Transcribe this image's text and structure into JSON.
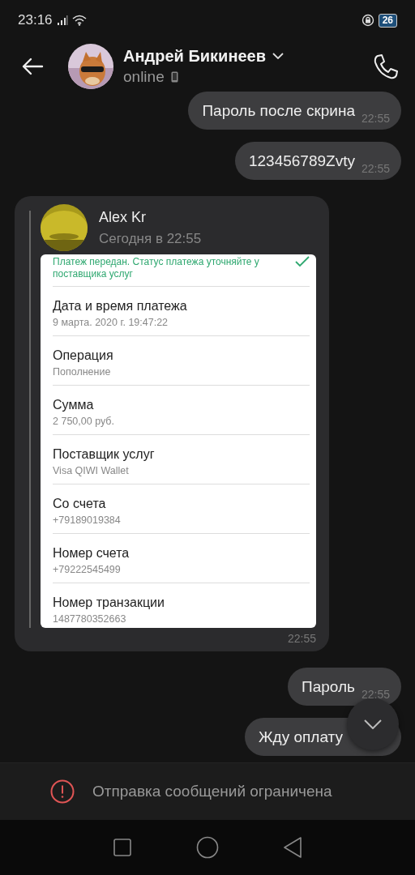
{
  "status_bar": {
    "time": "23:16",
    "battery": "26"
  },
  "header": {
    "name": "Андрей Бикинеев",
    "presence": "online"
  },
  "messages": [
    {
      "kind": "text",
      "text": "Пароль после скрина",
      "time": "22:55"
    },
    {
      "kind": "text",
      "text": "123456789Zvty",
      "time": "22:55"
    },
    {
      "kind": "forward",
      "author": "Alex Kr",
      "date": "Сегодня в 22:55",
      "time": "22:55",
      "screenshot": {
        "status": "Платеж передан. Статус платежа уточняйте у поставщика услуг",
        "rows": [
          {
            "label": "Дата и время платежа",
            "value": "9 марта. 2020 г. 19:47:22"
          },
          {
            "label": "Операция",
            "value": "Пополнение"
          },
          {
            "label": "Сумма",
            "value": "2 750,00 руб."
          },
          {
            "label": "Поставщик услуг",
            "value": "Visa QIWI Wallet"
          },
          {
            "label": "Со счета",
            "value": "+79189019384"
          },
          {
            "label": "Номер счета",
            "value": "+79222545499"
          },
          {
            "label": "Номер транзакции",
            "value": "1487780352663"
          }
        ]
      }
    },
    {
      "kind": "text",
      "text": "Пароль",
      "time": "22:55"
    },
    {
      "kind": "text",
      "text": "Жду оплату"
    }
  ],
  "footer": {
    "notice": "Отправка сообщений ограничена"
  }
}
